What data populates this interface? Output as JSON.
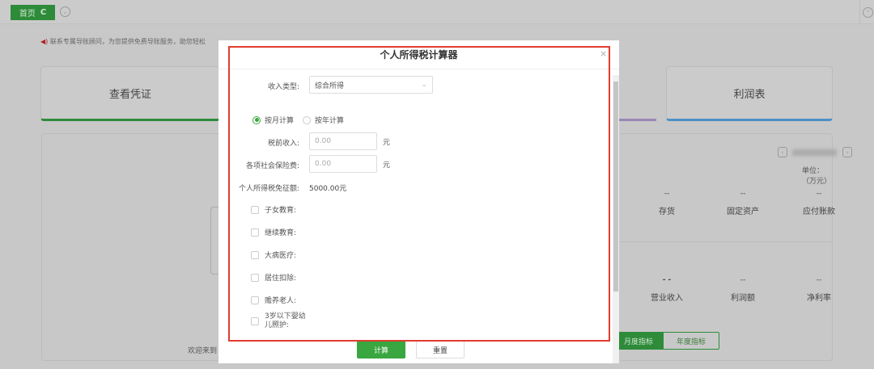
{
  "topbar": {
    "home_tab": "首页",
    "refresh_icon": "C"
  },
  "notice": "联系专属导账顾问，为您提供免费导账服务，助您轻松",
  "cards": [
    {
      "label": "查看凭证",
      "color": "#2e8b3a"
    },
    {
      "label": "利润表",
      "color": "#4a90c8"
    }
  ],
  "dashboard": {
    "unit": "单位：（万元）",
    "stats_row1": [
      {
        "label": "存货",
        "value": "--"
      },
      {
        "label": "固定资产",
        "value": "--"
      },
      {
        "label": "应付账款",
        "value": "--"
      }
    ],
    "stats_row2": [
      {
        "label": "营业收入",
        "value": "- -"
      },
      {
        "label": "利润额",
        "value": "--"
      },
      {
        "label": "净利率",
        "value": "--"
      }
    ],
    "monthly_tab": "月度指标",
    "yearly_tab": "年度指标",
    "welcome": "欢迎来到"
  },
  "modal": {
    "title": "个人所得税计算器",
    "income_type_label": "收入类型:",
    "income_type_value": "综合所得",
    "radio_monthly": "按月计算",
    "radio_yearly": "按年计算",
    "pretax_label": "税前收入:",
    "pretax_placeholder": "0.00",
    "insurance_label": "各项社会保险费:",
    "insurance_placeholder": "0.00",
    "unit_yuan": "元",
    "exemption_label": "个人所得税免征额:",
    "exemption_value": "5000.00元",
    "deductions": [
      "子女教育:",
      "继续教育:",
      "大病医疗:",
      "居住扣除:",
      "赡养老人:",
      "3岁以下婴幼儿照护:"
    ],
    "calc_button": "计算",
    "reset_button": "重置"
  },
  "colors": {
    "accent": "#3aa640",
    "highlight": "#e03c30"
  }
}
